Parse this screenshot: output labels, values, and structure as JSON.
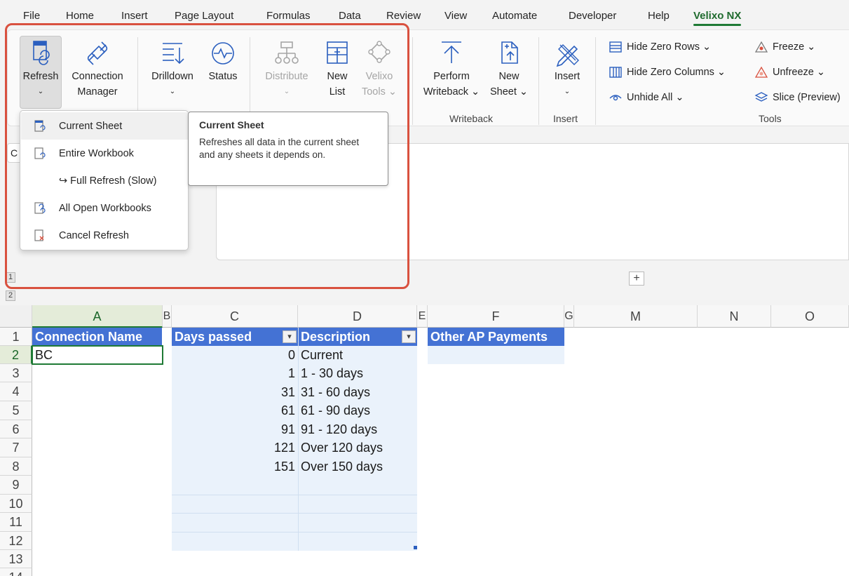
{
  "menu": {
    "tabs": [
      "File",
      "Home",
      "Insert",
      "Page Layout",
      "Formulas",
      "Data",
      "Review",
      "View",
      "Automate",
      "Developer",
      "Help",
      "Velixo NX"
    ],
    "active_tab": "Velixo NX"
  },
  "ribbon": {
    "refresh": {
      "line1": "Refresh",
      "chevron": "⌄"
    },
    "connection_manager": {
      "line1": "Connection",
      "line2": "Manager"
    },
    "drilldown": {
      "line1": "Drilldown",
      "chevron": "⌄"
    },
    "status": {
      "line1": "Status"
    },
    "distribute": {
      "line1": "Distribute",
      "chevron": "⌄"
    },
    "new_list": {
      "line1": "New",
      "line2": "List"
    },
    "velixo_tools": {
      "line1": "Velixo",
      "line2": "Tools ⌄"
    },
    "perform_writeback": {
      "line1": "Perform",
      "line2": "Writeback ⌄"
    },
    "new_sheet": {
      "line1": "New",
      "line2": "Sheet ⌄"
    },
    "insert": {
      "line1": "Insert",
      "chevron": "⌄"
    },
    "hide_zero_rows": "Hide Zero Rows ⌄",
    "hide_zero_columns": "Hide Zero Columns ⌄",
    "unhide_all": "Unhide All ⌄",
    "freeze": "Freeze ⌄",
    "unfreeze": "Unfreeze ⌄",
    "slice": "Slice (Preview)",
    "groups": {
      "writeback": "Writeback",
      "insert": "Insert",
      "tools": "Tools"
    }
  },
  "refresh_menu": {
    "items": [
      {
        "label": "Current Sheet",
        "icon": "refresh-sheet-icon"
      },
      {
        "label": "Entire Workbook",
        "icon": "refresh-workbook-icon"
      },
      {
        "label": "↪ Full Refresh (Slow)",
        "icon": ""
      },
      {
        "label": "All Open Workbooks",
        "icon": "refresh-all-icon"
      },
      {
        "label": "Cancel Refresh",
        "icon": "cancel-refresh-icon"
      }
    ]
  },
  "tooltip": {
    "title": "Current Sheet",
    "body": "Refreshes all data in the current sheet and any sheets it depends on."
  },
  "namebox": {
    "value": "C"
  },
  "outline": {
    "level1": "1",
    "level2": "2",
    "expand": "+"
  },
  "sheet": {
    "columns": [
      "A",
      "B",
      "C",
      "D",
      "E",
      "F",
      "G",
      "M",
      "N",
      "O"
    ],
    "rows": [
      "1",
      "2",
      "3",
      "4",
      "5",
      "6",
      "7",
      "8",
      "9",
      "10",
      "11",
      "12",
      "13",
      "14"
    ],
    "table1": {
      "header": "Connection Name",
      "values": [
        "BC"
      ]
    },
    "table2": {
      "headers": [
        "Days passed",
        "Description"
      ],
      "rows": [
        [
          "0",
          "Current"
        ],
        [
          "1",
          "1 - 30 days"
        ],
        [
          "31",
          "31 - 60 days"
        ],
        [
          "61",
          "61 - 90 days"
        ],
        [
          "91",
          "91 - 120 days"
        ],
        [
          "121",
          "Over 120 days"
        ],
        [
          "151",
          "Over 150 days"
        ]
      ]
    },
    "table3": {
      "header": "Other AP Payments"
    }
  },
  "colors": {
    "accent": "#1f7a35",
    "table_header": "#4472d4",
    "table_band": "#eaf2fb",
    "highlight_outline": "#d9513f"
  }
}
